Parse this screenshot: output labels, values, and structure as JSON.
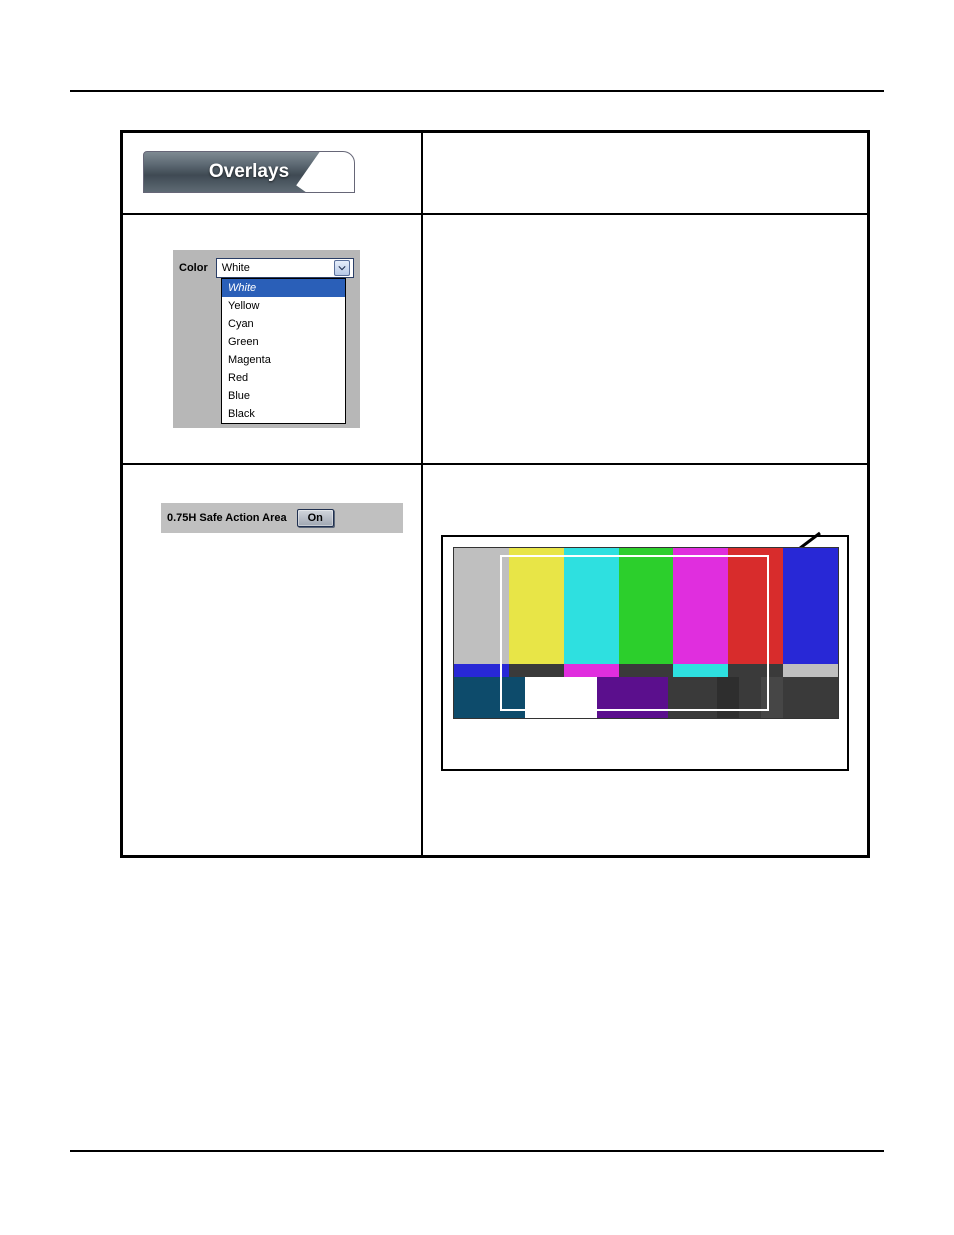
{
  "overlays": {
    "tab_label": "Overlays"
  },
  "color": {
    "label": "Color",
    "selected": "White",
    "options": [
      "White",
      "Yellow",
      "Cyan",
      "Green",
      "Magenta",
      "Red",
      "Blue",
      "Black"
    ]
  },
  "safe_action": {
    "label": "0.75H Safe Action Area",
    "toggle": "On"
  }
}
